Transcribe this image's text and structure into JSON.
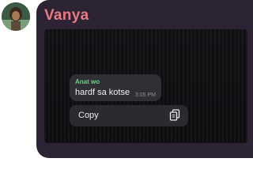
{
  "header": {
    "sender_name": "Vanya",
    "name_color": "#e77b86",
    "avatar_icon": "profile-photo"
  },
  "message": {
    "author": "Anat wo",
    "author_color": "#6fd08a",
    "text": "hardf sa kotse",
    "time": "3:05 PM"
  },
  "context_menu": {
    "items": [
      {
        "label": "Copy",
        "icon": "copy-icon"
      }
    ]
  }
}
